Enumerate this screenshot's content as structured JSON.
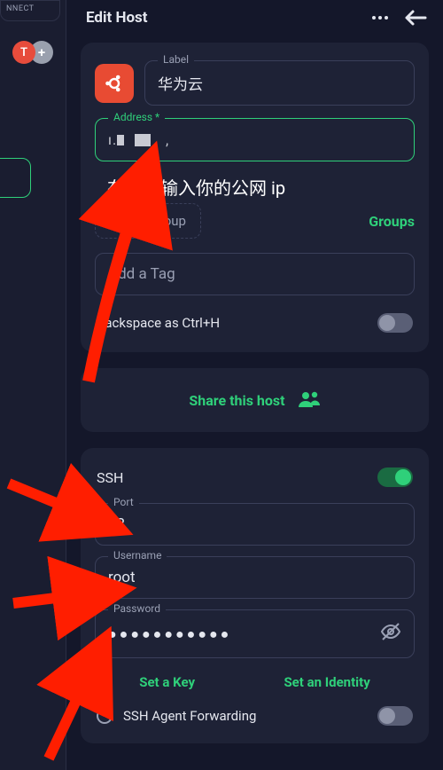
{
  "rail": {
    "connect_label": "NNECT",
    "avatar_letter": "T",
    "add_symbol": "+"
  },
  "header": {
    "title": "Edit Host"
  },
  "form": {
    "label_legend": "Label",
    "label_value": "华为云",
    "address_legend": "Address *",
    "address_value_hint": "ı.▮ ▮▮  ,",
    "annotation": "在此处输入你的公网 ip",
    "parent_group_placeholder": "Parent group",
    "groups_link": "Groups",
    "tag_placeholder": "Add a Tag",
    "backspace_label": "Backspace as Ctrl+H",
    "backspace_on": false
  },
  "share": {
    "label": "Share this host"
  },
  "ssh": {
    "title": "SSH",
    "enabled": true,
    "port_legend": "Port",
    "port_value": "22",
    "username_legend": "Username",
    "username_value": "root",
    "password_legend": "Password",
    "password_mask": "●●●●●●●●●●●",
    "set_key": "Set a Key",
    "set_identity": "Set an Identity",
    "agent_forwarding": "SSH Agent Forwarding",
    "agent_on": false
  },
  "colors": {
    "accent": "#2fd07a",
    "arrow": "#ff1e00"
  }
}
